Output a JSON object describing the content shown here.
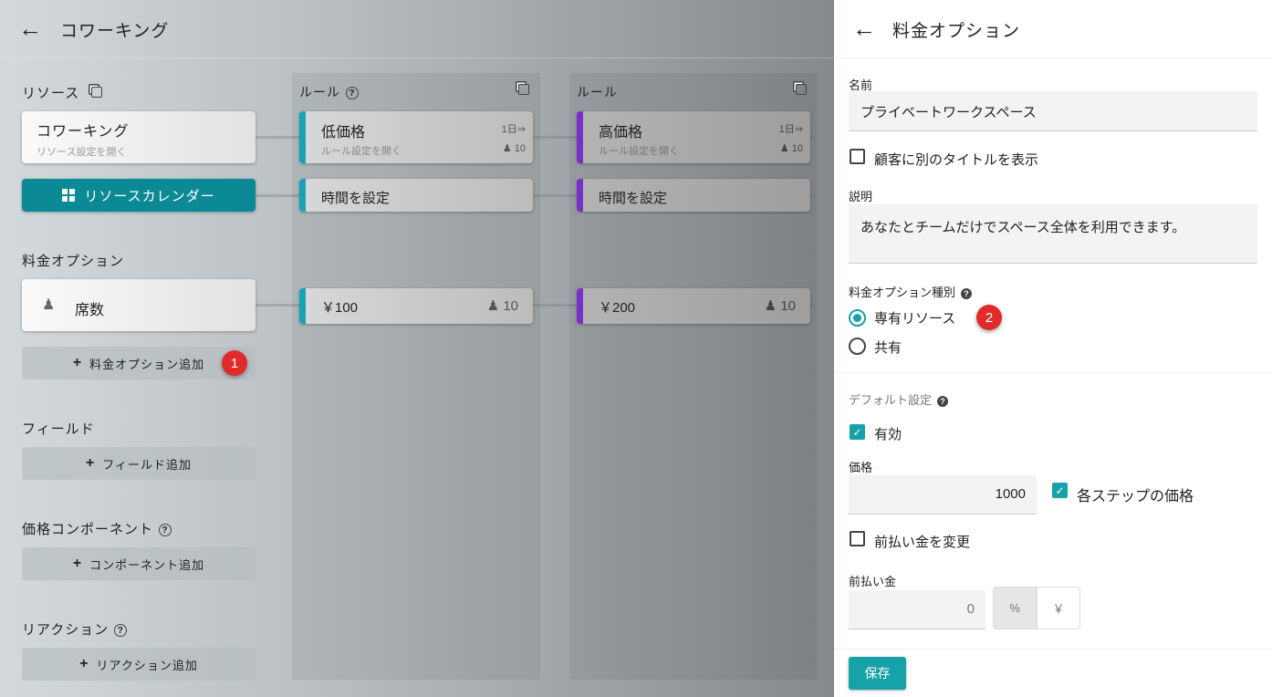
{
  "header": {
    "title": "コワーキング"
  },
  "resource": {
    "section": "リソース",
    "card_title": "コワーキング",
    "card_sub": "リソース設定を開く",
    "calendar_btn": "リソースカレンダー"
  },
  "pricing": {
    "section": "料金オプション",
    "option": "席数",
    "add_btn": "料金オプション追加"
  },
  "fields": {
    "section": "フィールド",
    "add_btn": "フィールド追加"
  },
  "components": {
    "section": "価格コンポーネント",
    "add_btn": "コンポーネント追加"
  },
  "reactions": {
    "section": "リアクション",
    "add_btn": "リアクション追加"
  },
  "rules": [
    {
      "header": "ルール",
      "name": "低価格",
      "sub": "ルール設定を開く",
      "period": "1日⇒",
      "cap": "10",
      "time": "時間を設定",
      "price": "￥100",
      "price_cap": "10",
      "color": "#17a2b8"
    },
    {
      "header": "ルール",
      "name": "高価格",
      "sub": "ルール設定を開く",
      "period": "1日⇒",
      "cap": "10",
      "time": "時間を設定",
      "price": "￥200",
      "price_cap": "10",
      "color": "#7b2fc9"
    }
  ],
  "badges": [
    "1",
    "2"
  ],
  "panel": {
    "title": "料金オプション",
    "name_label": "名前",
    "name_value": "プライベートワークスペース",
    "alt_title_label": "顧客に別のタイトルを表示",
    "desc_label": "説明",
    "desc_value": "あなたとチームだけでスペース全体を利用できます。",
    "type_label": "料金オプション種別",
    "type_options": [
      "専有リソース",
      "共有"
    ],
    "defaults_label": "デフォルト設定",
    "enabled_label": "有効",
    "price_label": "価格",
    "price_value": "1000",
    "per_step_label": "各ステップの価格",
    "change_deposit_label": "前払い金を変更",
    "deposit_label": "前払い金",
    "deposit_value": "0",
    "unit_percent": "%",
    "unit_yen": "￥",
    "save": "保存"
  },
  "colors": {
    "accent": "#17a2a8",
    "badge": "#e02b2b"
  }
}
